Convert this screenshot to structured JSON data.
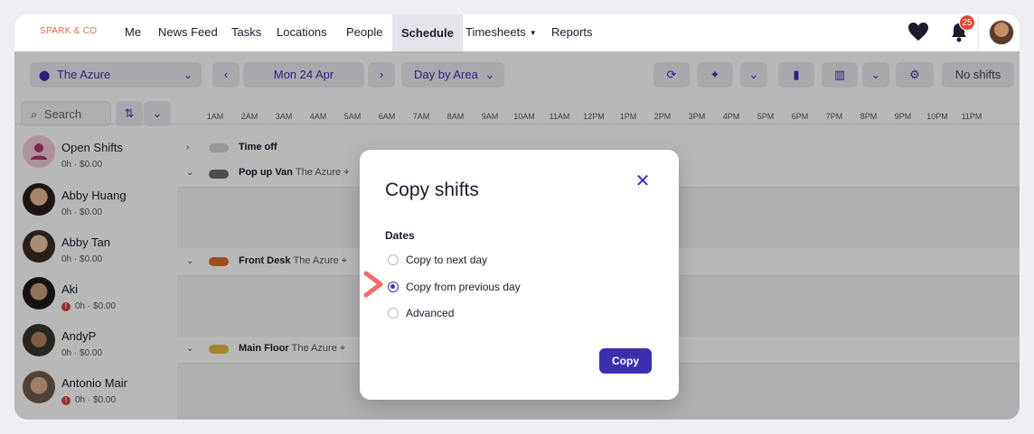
{
  "brand": "SPARK & CO",
  "nav": {
    "items": [
      "Me",
      "News Feed",
      "Tasks",
      "Locations",
      "People",
      "Schedule",
      "Timesheets",
      "Reports"
    ],
    "active": "Schedule",
    "notifications_count": "25"
  },
  "toolbar": {
    "location": "The Azure",
    "date": "Mon 24 Apr",
    "view": "Day by Area",
    "no_shifts_label": "No shifts",
    "search_placeholder": "Search"
  },
  "timeline": {
    "hours": [
      "1AM",
      "2AM",
      "3AM",
      "4AM",
      "5AM",
      "6AM",
      "7AM",
      "8AM",
      "9AM",
      "10AM",
      "11AM",
      "12PM",
      "1PM",
      "2PM",
      "3PM",
      "4PM",
      "5PM",
      "6PM",
      "7PM",
      "8PM",
      "9PM",
      "10PM",
      "11PM"
    ]
  },
  "people": [
    {
      "name": "Open Shifts",
      "info": "0h · $0.00",
      "warning": false
    },
    {
      "name": "Abby Huang",
      "info": "0h · $0.00",
      "warning": false
    },
    {
      "name": "Abby Tan",
      "info": "0h · $0.00",
      "warning": false
    },
    {
      "name": "Aki",
      "info": "0h · $0.00",
      "warning": true
    },
    {
      "name": "AndyP",
      "info": "0h · $0.00",
      "warning": false
    },
    {
      "name": "Antonio Mair",
      "info": "0h · $0.00",
      "warning": true
    }
  ],
  "areas": [
    {
      "name": "Time off",
      "location": "",
      "color": "#d3d3d8"
    },
    {
      "name": "Pop up Van",
      "location": "The Azure",
      "color": "#6a6a70"
    },
    {
      "name": "Front Desk",
      "location": "The Azure",
      "color": "#e0692e"
    },
    {
      "name": "Main Floor",
      "location": "The Azure",
      "color": "#e8b93c"
    }
  ],
  "modal": {
    "title": "Copy shifts",
    "section_label": "Dates",
    "options": [
      "Copy to next day",
      "Copy from previous day",
      "Advanced"
    ],
    "selected": "Copy from previous day",
    "confirm_label": "Copy"
  },
  "colors": {
    "accent": "#3b2fb0",
    "brand": "#e86a4a",
    "badge": "#e2473a"
  }
}
